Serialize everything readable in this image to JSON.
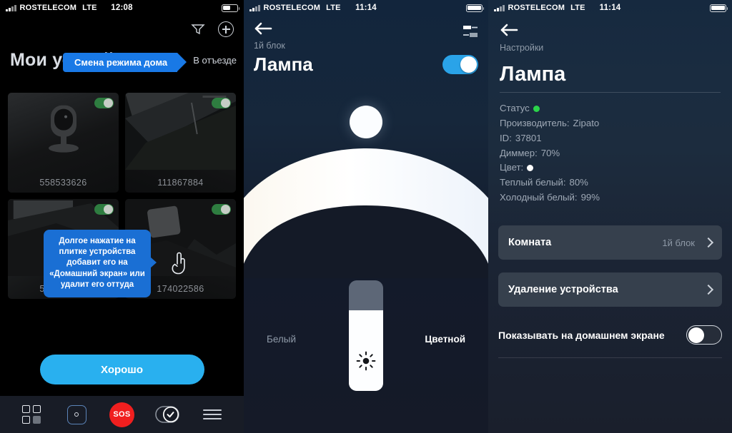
{
  "panels": {
    "devices": {
      "status_bar": {
        "carrier": "ROSTELECOM",
        "network": "LTE",
        "time": "12:08"
      },
      "title": "Мои устройства",
      "mode_pill": "Смена режима дома",
      "away_label": "В отъезде",
      "icons": {
        "filter": "filter-icon",
        "add": "plus-icon"
      },
      "tiles": [
        {
          "name": "558533626",
          "toggle": "on",
          "thumb": "camera-icon"
        },
        {
          "name": "111867884",
          "toggle": "on",
          "thumb": "camera-snapshot"
        },
        {
          "name": "558533626",
          "toggle": "on",
          "thumb": "camera-snapshot"
        },
        {
          "name": "174022586",
          "toggle": "on",
          "thumb": "camera-snapshot"
        }
      ],
      "tooltip": "Долгое нажатие на плитке устройства добавит его на «Домашний экран» или удалит его оттуда",
      "ok_button": "Хорошо",
      "nav": [
        {
          "name": "grid",
          "label": ""
        },
        {
          "name": "sensor",
          "label": ""
        },
        {
          "name": "sos",
          "label": "SOS"
        },
        {
          "name": "scenarios",
          "label": ""
        },
        {
          "name": "menu",
          "label": ""
        }
      ]
    },
    "lamp": {
      "status_bar": {
        "carrier": "ROSTELECOM",
        "network": "LTE",
        "time": "11:14"
      },
      "breadcrumb": "1й блок",
      "title": "Лампа",
      "power_toggle": "on",
      "white_label": "Белый",
      "color_label": "Цветной",
      "brightness_percent": 73
    },
    "settings": {
      "status_bar": {
        "carrier": "ROSTELECOM",
        "network": "LTE",
        "time": "11:14"
      },
      "breadcrumb": "Настройки",
      "title": "Лампа",
      "info": [
        {
          "label": "Статус",
          "value": "",
          "swatch": "green"
        },
        {
          "label": "Производитель:",
          "value": "Zipato",
          "swatch": ""
        },
        {
          "label": "ID:",
          "value": "37801",
          "swatch": ""
        },
        {
          "label": "Диммер:",
          "value": "70%",
          "swatch": ""
        },
        {
          "label": "Цвет:",
          "value": "",
          "swatch": "white"
        },
        {
          "label": "Теплый белый:",
          "value": "80%",
          "swatch": ""
        },
        {
          "label": "Холодный белый:",
          "value": "99%",
          "swatch": ""
        }
      ],
      "room_card": {
        "label": "Комната",
        "value": "1й блок"
      },
      "delete_card": {
        "label": "Удаление устройства",
        "value": ""
      },
      "home_screen_switch": {
        "label": "Показывать на домашнем экране",
        "state": "off"
      }
    }
  },
  "colors": {
    "accent_blue": "#29b0ef",
    "pill_blue": "#1979e6",
    "tooltip_blue": "#1a6fd4",
    "sos_red": "#f01f1f",
    "status_green": "#2bd44a"
  }
}
